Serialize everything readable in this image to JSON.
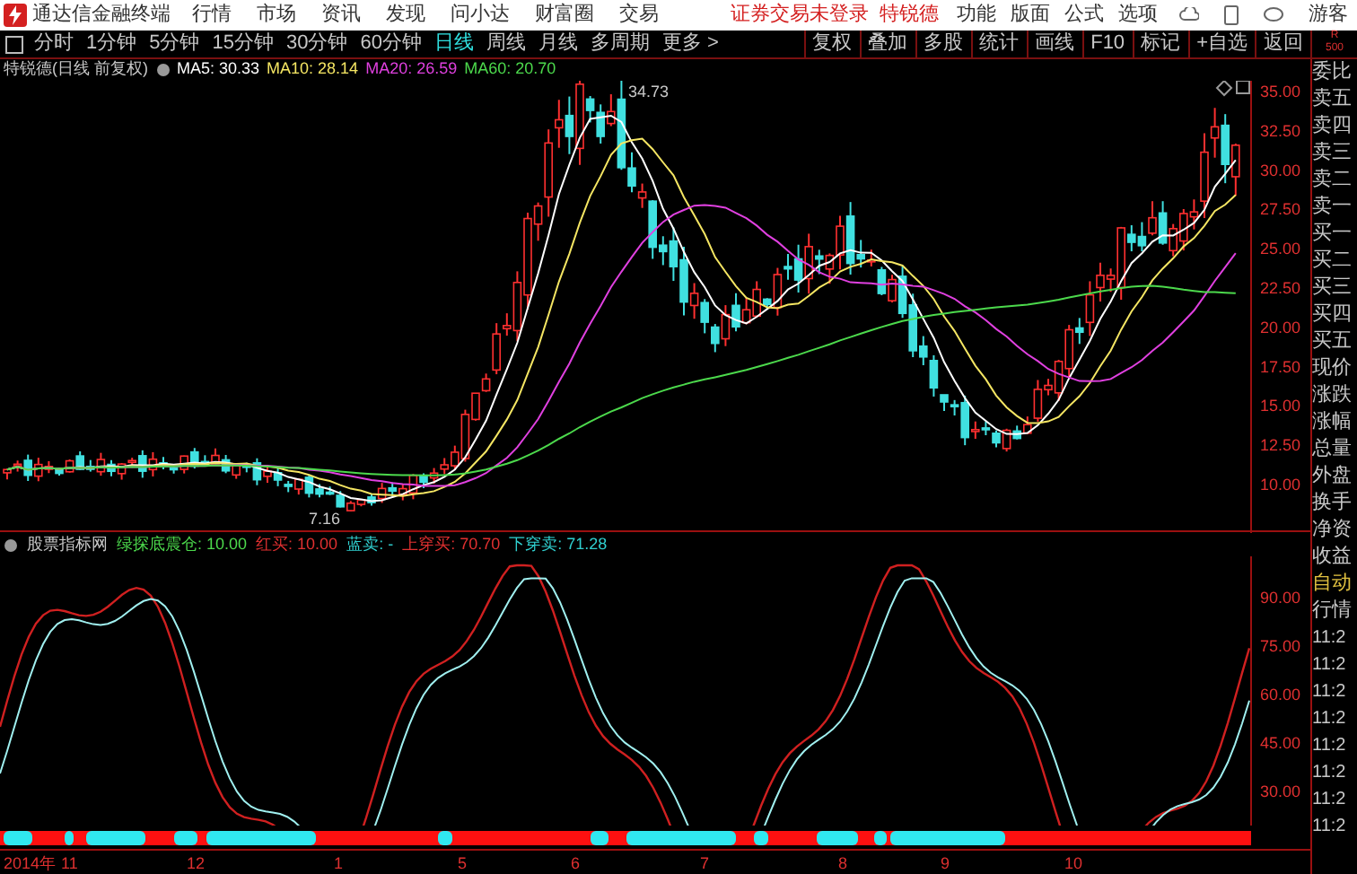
{
  "app": {
    "title": "通达信金融终端"
  },
  "menu": [
    "行情",
    "市场",
    "资讯",
    "发现",
    "问小达",
    "财富圈",
    "交易"
  ],
  "login_status": "证券交易未登录",
  "stock_link": "特锐德",
  "right_menu": [
    "功能",
    "版面",
    "公式",
    "选项"
  ],
  "user": "游客",
  "periods": [
    {
      "label": "分时",
      "selected": false
    },
    {
      "label": "1分钟",
      "selected": false
    },
    {
      "label": "5分钟",
      "selected": false
    },
    {
      "label": "15分钟",
      "selected": false
    },
    {
      "label": "30分钟",
      "selected": false
    },
    {
      "label": "60分钟",
      "selected": false
    },
    {
      "label": "日线",
      "selected": true
    },
    {
      "label": "周线",
      "selected": false
    },
    {
      "label": "月线",
      "selected": false
    },
    {
      "label": "多周期",
      "selected": false
    },
    {
      "label": "更多 >",
      "selected": false
    }
  ],
  "tools": [
    "复权",
    "叠加",
    "多股",
    "统计",
    "画线",
    "F10",
    "标记",
    "+自选",
    "返回"
  ],
  "corner_label": [
    "R",
    "500"
  ],
  "chart": {
    "title": "特锐德(日线 前复权)",
    "indicators": [
      {
        "label": "MA5: 30.33",
        "color": "#ffffff"
      },
      {
        "label": "MA10: 28.14",
        "color": "#f5e663"
      },
      {
        "label": "MA20: 26.59",
        "color": "#e040e0"
      },
      {
        "label": "MA60: 20.70",
        "color": "#4cd94c"
      }
    ],
    "high_label": "34.73",
    "low_label": "7.16",
    "price_ticks": [
      "35.00",
      "32.50",
      "30.00",
      "27.50",
      "25.00",
      "22.50",
      "20.00",
      "17.50",
      "15.00",
      "12.50",
      "10.00"
    ]
  },
  "indicator": {
    "title": "股票指标网",
    "items": [
      {
        "label": "绿探底震仓: 10.00",
        "color": "#4cd94c"
      },
      {
        "label": "红买: 10.00",
        "color": "#e03030"
      },
      {
        "label": "蓝卖: -",
        "color": "#30d0d0"
      },
      {
        "label": "上穿买: 70.70",
        "color": "#e03030"
      },
      {
        "label": "下穿卖: 71.28",
        "color": "#30d0d0"
      }
    ],
    "ticks": [
      "90.00",
      "75.00",
      "60.00",
      "45.00",
      "30.00"
    ]
  },
  "date_axis": [
    "2014年",
    "11",
    "12",
    "1",
    "5",
    "6",
    "7",
    "8",
    "9",
    "10"
  ],
  "quote_panel": {
    "labels": [
      "委比",
      "卖五",
      "卖四",
      "卖三",
      "卖二",
      "卖一",
      "买一",
      "买二",
      "买三",
      "买四",
      "买五",
      "现价",
      "涨跌",
      "涨幅",
      "总量",
      "外盘",
      "换手",
      "净资",
      "收益"
    ],
    "mode": "自动",
    "section": "行情",
    "times": [
      "11:2",
      "11:2",
      "11:2",
      "11:2",
      "11:2",
      "11:2",
      "11:2",
      "11:2"
    ]
  }
}
